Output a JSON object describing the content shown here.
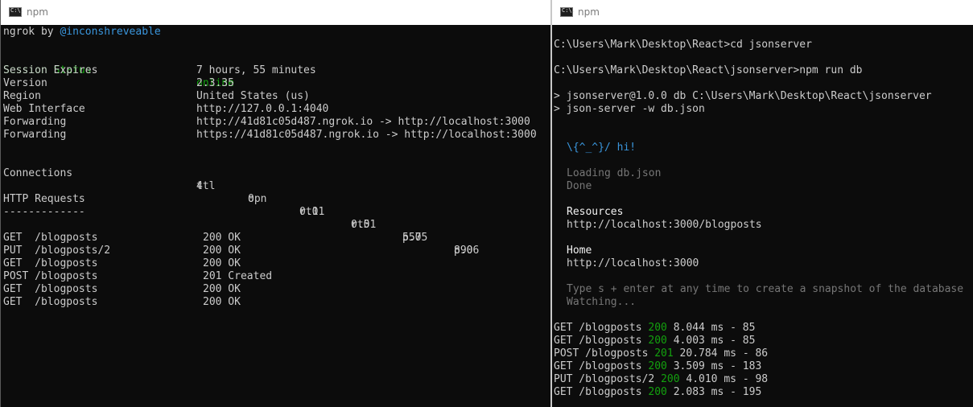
{
  "windows": {
    "left_title": "npm",
    "right_title": "npm",
    "icon_text": "C:\\."
  },
  "ngrok": {
    "header_prefix": "ngrok by ",
    "header_author": "@inconshreveable",
    "status_label": "Session Status",
    "status_value": "online",
    "fields": [
      {
        "label": "Session Expires",
        "value": "7 hours, 55 minutes"
      },
      {
        "label": "Version",
        "value": "2.3.35"
      },
      {
        "label": "Region",
        "value": "United States (us)"
      },
      {
        "label": "Web Interface",
        "value": "http://127.0.0.1:4040"
      },
      {
        "label": "Forwarding",
        "value": "http://41d81c05d487.ngrok.io -> http://localhost:3000"
      },
      {
        "label": "Forwarding",
        "value": "https://41d81c05d487.ngrok.io -> http://localhost:3000"
      }
    ],
    "connections_label": "Connections",
    "connection_headers": [
      "ttl",
      "opn",
      "rt1",
      "rt5",
      "p50",
      "p90"
    ],
    "connection_values": [
      "4",
      "0",
      "0.01",
      "0.01",
      "5.75",
      "8.06"
    ],
    "http_requests_label": "HTTP Requests",
    "http_requests_rule": "-------------",
    "requests": [
      {
        "req": "GET  /blogposts",
        "status": "200 OK"
      },
      {
        "req": "PUT  /blogposts/2",
        "status": "200 OK"
      },
      {
        "req": "GET  /blogposts",
        "status": "200 OK"
      },
      {
        "req": "POST /blogposts",
        "status": "201 Created"
      },
      {
        "req": "GET  /blogposts",
        "status": "200 OK"
      },
      {
        "req": "GET  /blogposts",
        "status": "200 OK"
      }
    ]
  },
  "json_server": {
    "cmd1": "C:\\Users\\Mark\\Desktop\\React>cd jsonserver",
    "cmd2": "C:\\Users\\Mark\\Desktop\\React\\jsonserver>npm run db",
    "npm1": "> jsonserver@1.0.0 db C:\\Users\\Mark\\Desktop\\React\\jsonserver",
    "npm2": "> json-server -w db.json",
    "banner": "\\{^_^}/ hi!",
    "loading": "Loading db.json",
    "done": "Done",
    "resources_label": "Resources",
    "resources_url": "http://localhost:3000/blogposts",
    "home_label": "Home",
    "home_url": "http://localhost:3000",
    "snapshot_hint": "Type s + enter at any time to create a snapshot of the database",
    "watching": "Watching...",
    "log": [
      {
        "req": "GET /blogposts",
        "status": "200",
        "rest": "8.044 ms - 85"
      },
      {
        "req": "GET /blogposts",
        "status": "200",
        "rest": "4.003 ms - 85"
      },
      {
        "req": "POST /blogposts",
        "status": "201",
        "rest": "20.784 ms - 86"
      },
      {
        "req": "GET /blogposts",
        "status": "200",
        "rest": "3.509 ms - 183"
      },
      {
        "req": "PUT /blogposts/2",
        "status": "200",
        "rest": "4.010 ms - 98"
      },
      {
        "req": "GET /blogposts",
        "status": "200",
        "rest": "2.083 ms - 195"
      }
    ]
  },
  "colors": {
    "terminal_bg": "#0c0c0c",
    "text": "#cccccc",
    "green": "#13a10e",
    "cyan": "#3a96dd",
    "dim": "#767676"
  }
}
